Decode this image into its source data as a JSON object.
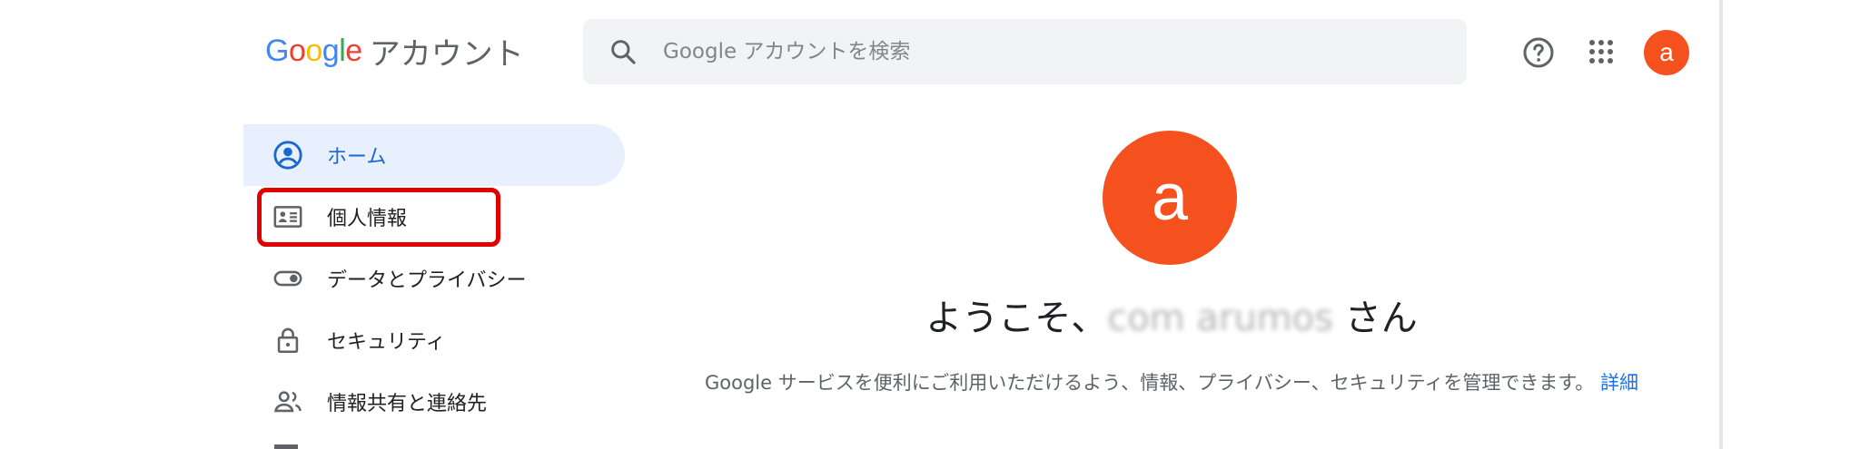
{
  "header": {
    "logo_google": "Google",
    "logo_product": "アカウント",
    "search_placeholder": "Google アカウントを検索",
    "avatar_letter": "a"
  },
  "sidebar": {
    "items": [
      {
        "label": "ホーム",
        "icon": "account-circle-icon",
        "active": true
      },
      {
        "label": "個人情報",
        "icon": "id-card-icon",
        "highlighted": true
      },
      {
        "label": "データとプライバシー",
        "icon": "toggle-icon"
      },
      {
        "label": "セキュリティ",
        "icon": "lock-icon"
      },
      {
        "label": "情報共有と連絡先",
        "icon": "people-icon"
      }
    ]
  },
  "main": {
    "avatar_letter": "a",
    "welcome_prefix": "ようこそ、",
    "welcome_name": "com arumos",
    "welcome_suffix": " さん",
    "description": "Google サービスを便利にご利用いただけるよう、情報、プライバシー、セキュリティを管理できます。",
    "details_link": "詳細"
  },
  "colors": {
    "accent": "#1967d2",
    "avatar": "#f4511e",
    "active_bg": "#e8f0fe",
    "highlight": "#e00000"
  }
}
